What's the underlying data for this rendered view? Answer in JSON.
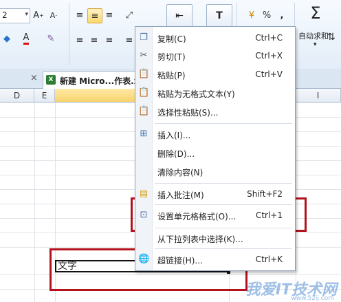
{
  "ribbon": {
    "font_size": "2",
    "autosum_label": "自动求和",
    "percent": "%",
    "comma": ",",
    "sigma": "Σ"
  },
  "tabs": {
    "close": "×",
    "doc_title": "新建 Micro...作表.x",
    "xls_glyph": "X"
  },
  "columns": [
    "D",
    "E",
    "I"
  ],
  "cell": {
    "text": "文字"
  },
  "menu": {
    "items": [
      {
        "label": "复制(C)",
        "shortcut": "Ctrl+C",
        "icon": "copy-icon"
      },
      {
        "label": "剪切(T)",
        "shortcut": "Ctrl+X",
        "icon": "scissors-icon"
      },
      {
        "label": "粘贴(P)",
        "shortcut": "Ctrl+V",
        "icon": "paste-icon"
      },
      {
        "label": "粘贴为无格式文本(Y)",
        "shortcut": "",
        "icon": "paste-text-icon"
      },
      {
        "label": "选择性粘贴(S)...",
        "shortcut": "",
        "icon": "paste-special-icon"
      },
      {
        "label": "插入(I)...",
        "shortcut": "",
        "icon": "insert-icon"
      },
      {
        "label": "删除(D)...",
        "shortcut": "",
        "icon": ""
      },
      {
        "label": "清除内容(N)",
        "shortcut": "",
        "icon": ""
      },
      {
        "label": "插入批注(M)",
        "shortcut": "Shift+F2",
        "icon": "comment-icon"
      },
      {
        "label": "设置单元格格式(O)...",
        "shortcut": "Ctrl+1",
        "icon": "format-cells-icon"
      },
      {
        "label": "从下拉列表中选择(K)...",
        "shortcut": "",
        "icon": ""
      },
      {
        "label": "超链接(H)...",
        "shortcut": "Ctrl+K",
        "icon": "hyperlink-icon"
      }
    ]
  },
  "watermark": {
    "main": "我爱IT技术网",
    "sub": "www.52ij.com"
  }
}
